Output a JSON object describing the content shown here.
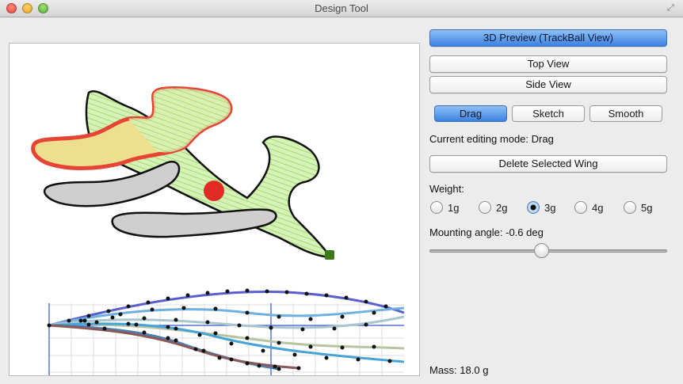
{
  "window": {
    "title": "Design Tool"
  },
  "buttons": {
    "preview3d": "3D Preview (TrackBall View)",
    "top_view": "Top View",
    "side_view": "Side View",
    "delete_wing": "Delete Selected Wing"
  },
  "modes": {
    "drag": "Drag",
    "sketch": "Sketch",
    "smooth": "Smooth",
    "selected": "Drag"
  },
  "status": {
    "editing_mode": "Current editing mode: Drag"
  },
  "weight": {
    "label": "Weight:",
    "options": [
      "1g",
      "2g",
      "3g",
      "4g",
      "5g"
    ],
    "selected": "3g"
  },
  "mounting": {
    "label": "Mounting angle: -0.6 deg",
    "value": -0.6,
    "slider_fraction": 0.47
  },
  "mass": {
    "label": "Mass: 18.0 g"
  },
  "colors": {
    "accent_blue": "#3d82e0",
    "wing_green": "#a6e36a",
    "wing_yellow": "#eedf8f",
    "selected_outline_red": "#e54534",
    "center_marker_red": "#e02a24",
    "grid_blue": "#3355cc"
  }
}
